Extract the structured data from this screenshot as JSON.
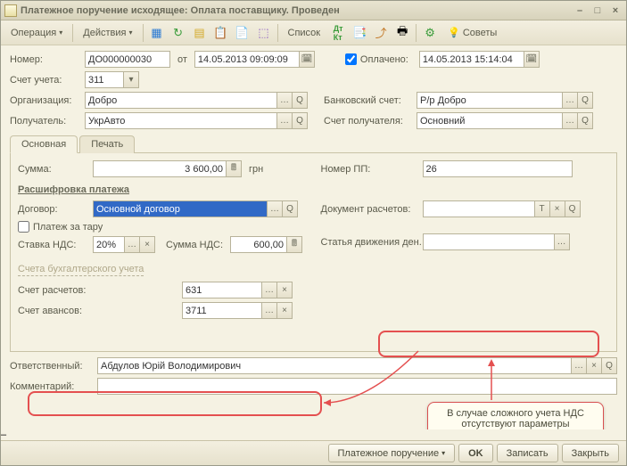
{
  "window": {
    "title": "Платежное поручение исходящее: Оплата поставщику. Проведен"
  },
  "toolbar": {
    "operation": "Операция",
    "actions": "Действия",
    "list": "Список",
    "tips": "Советы"
  },
  "fields": {
    "number_lbl": "Номер:",
    "number_val": "ДО000000030",
    "from_lbl": "от",
    "date_val": "14.05.2013 09:09:09",
    "paid_lbl": "Оплачено:",
    "paid_date": "14.05.2013 15:14:04",
    "account_lbl": "Счет учета:",
    "account_val": "311",
    "org_lbl": "Организация:",
    "org_val": "Добро",
    "bank_acc_lbl": "Банковский счет:",
    "bank_acc_val": "Р/р Добро",
    "recipient_lbl": "Получатель:",
    "recipient_val": "УкрАвто",
    "rec_acc_lbl": "Счет получателя:",
    "rec_acc_val": "Основний"
  },
  "tabs": {
    "main": "Основная",
    "print": "Печать"
  },
  "main_tab": {
    "sum_lbl": "Сумма:",
    "sum_val": "3 600,00",
    "currency": "грн",
    "pp_lbl": "Номер ПП:",
    "pp_val": "26",
    "decode_header": "Расшифровка платежа",
    "contract_lbl": "Договор:",
    "contract_val": "Основной договор",
    "doc_calc_lbl": "Документ расчетов:",
    "tare_lbl": "Платеж за тару",
    "vat_rate_lbl": "Ставка НДС:",
    "vat_rate_val": "20%",
    "vat_sum_lbl": "Сумма НДС:",
    "vat_sum_val": "600,00",
    "cash_flow_lbl": "Статья движения ден. средств:",
    "acc_section": "Счета бухгалтерского учета",
    "settle_acc_lbl": "Счет расчетов:",
    "settle_acc_val": "631",
    "advance_acc_lbl": "Счет авансов:",
    "advance_acc_val": "3711"
  },
  "bottom": {
    "responsible_lbl": "Ответственный:",
    "responsible_val": "Абдулов Юрій Володимирович",
    "comment_lbl": "Комментарий:"
  },
  "callout": {
    "text": "В случае сложного учета НДС отсутствуют параметры налогового учета и счета НДС"
  },
  "footer": {
    "payment_order": "Платежное поручение",
    "ok": "OK",
    "save": "Записать",
    "close": "Закрыть"
  }
}
